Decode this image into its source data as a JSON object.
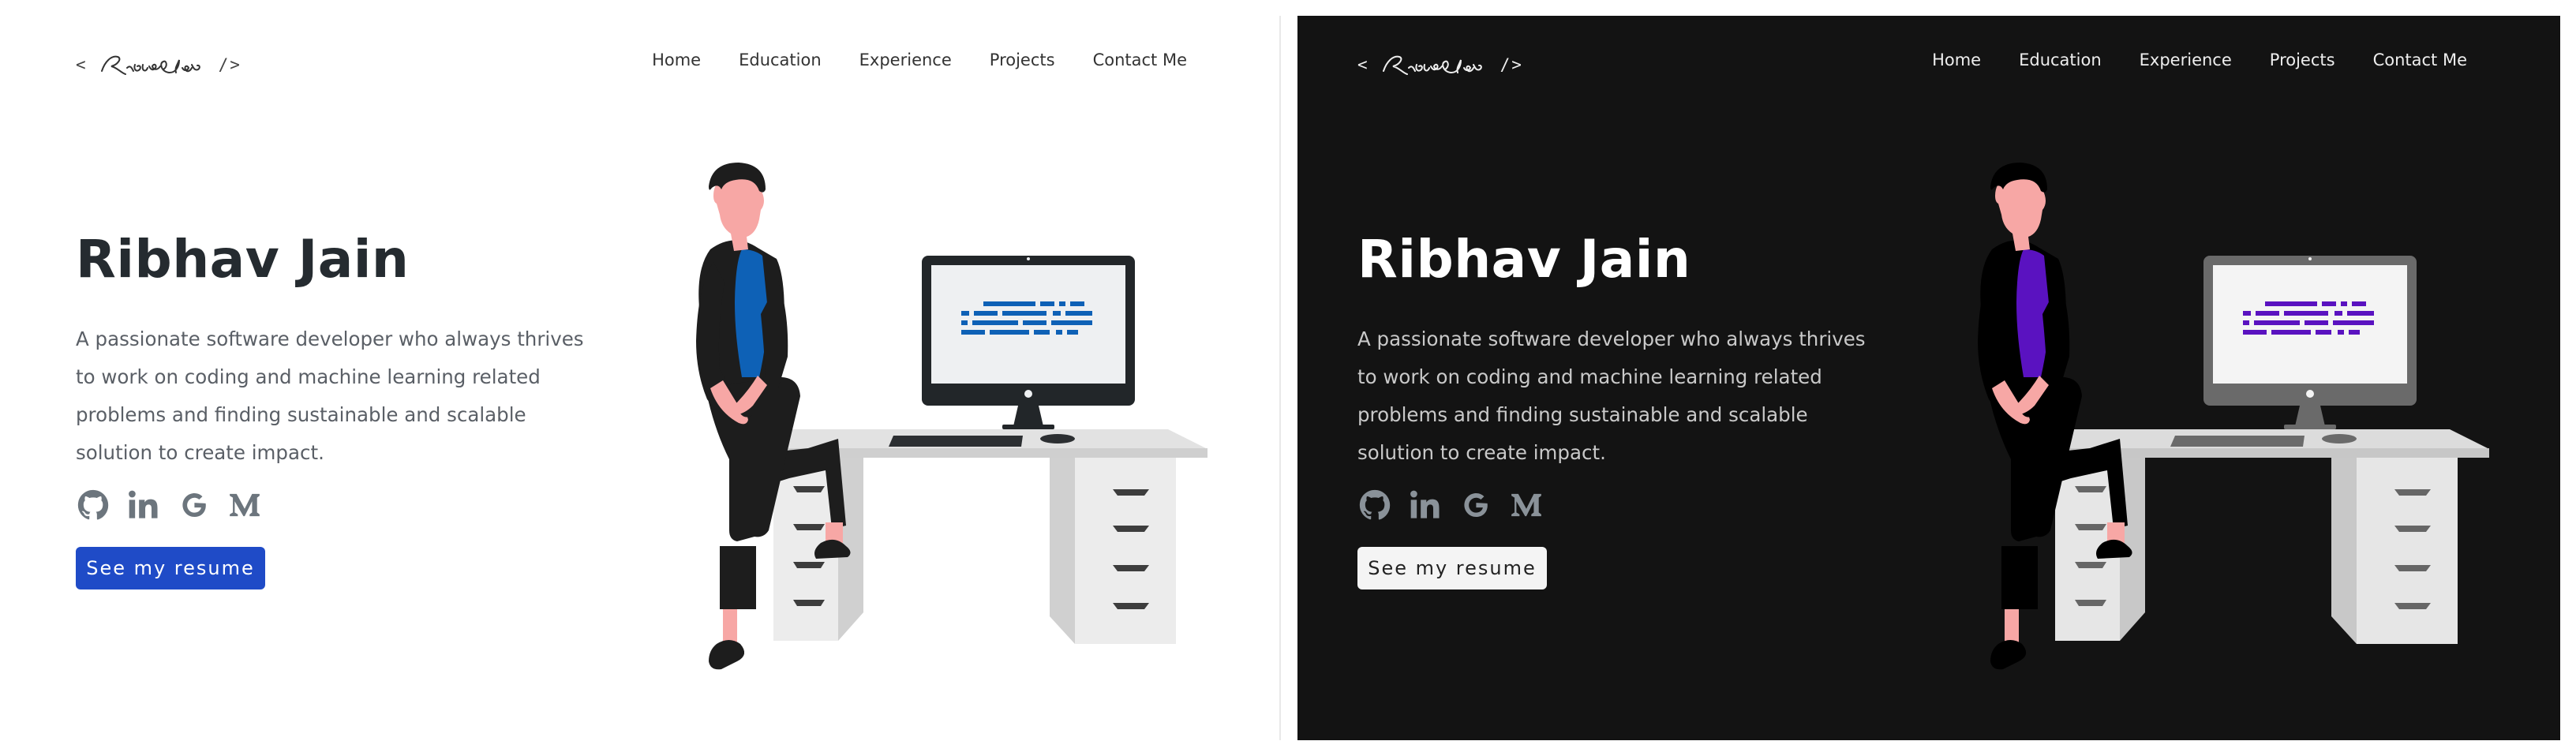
{
  "themes": {
    "light": {
      "background": "#ffffff",
      "accent": "#1f4bc7",
      "shirt_color": "#0e61b6",
      "code_color": "#0e61b6"
    },
    "dark": {
      "background": "#131313",
      "accent": "#f4f4f4",
      "shirt_color": "#5a12c0",
      "code_color": "#5a12c0"
    }
  },
  "logo": {
    "open_bracket": "<",
    "close_bracket": "/>",
    "signature_icon": "signature-ribhav-jain"
  },
  "nav": {
    "items": [
      "Home",
      "Education",
      "Experience",
      "Projects",
      "Contact Me"
    ]
  },
  "hero": {
    "title": "Ribhav Jain",
    "description": "A passionate software developer who always thrives to work on coding and machine learning related problems and finding sustainable and scalable solution to create impact.",
    "resume_label": "See my resume"
  },
  "socials": [
    {
      "icon": "github-icon"
    },
    {
      "icon": "linkedin-icon"
    },
    {
      "icon": "google-icon"
    },
    {
      "icon": "medium-icon"
    }
  ]
}
